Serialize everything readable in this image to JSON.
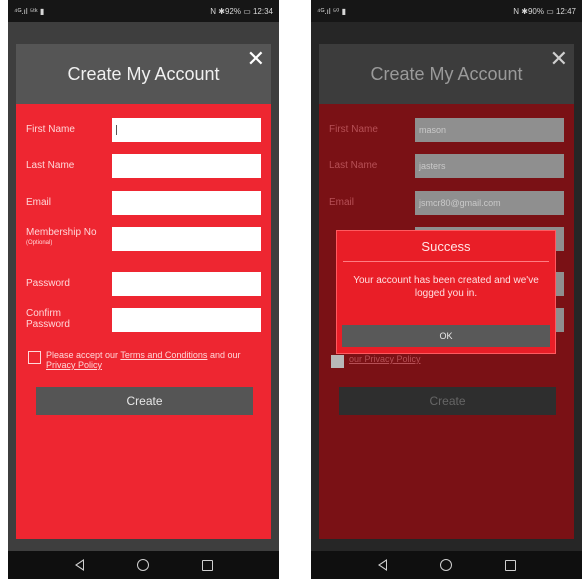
{
  "left": {
    "status": {
      "left": "⁴ᴳ.ıl ⁵ᵗᵏ ▮",
      "right": "N ✱92% ▭ 12:34"
    },
    "title": "Create My Account",
    "close": "✕",
    "fields": [
      {
        "label": "First Name",
        "value": ""
      },
      {
        "label": "Last Name",
        "value": ""
      },
      {
        "label": "Email",
        "value": ""
      },
      {
        "label": "Membership No",
        "sublabel": "(Optional)",
        "value": ""
      },
      {
        "label": "Password",
        "value": ""
      },
      {
        "label": "Confirm Password",
        "value": ""
      }
    ],
    "terms": {
      "prefix": "Please accept our ",
      "terms_link": "Terms and Conditions",
      "middle": " and our ",
      "privacy_link": "Privacy Policy"
    },
    "create": "Create"
  },
  "right": {
    "status": {
      "left": "⁴ᴳ.ıl ⁵⁰ ▮",
      "right": "N ✱90% ▭ 12:47"
    },
    "title": "Create My Account",
    "close": "✕",
    "fields": [
      {
        "label": "First Name",
        "value": "mason"
      },
      {
        "label": "Last Name",
        "value": "jasters"
      },
      {
        "label": "Email",
        "value": "jsmcr80@gmail.com"
      }
    ],
    "privacy_link": "our Privacy Policy",
    "create": "Create",
    "dialog": {
      "title": "Success",
      "message": "Your account has been created and we've logged you in.",
      "ok": "OK"
    }
  }
}
